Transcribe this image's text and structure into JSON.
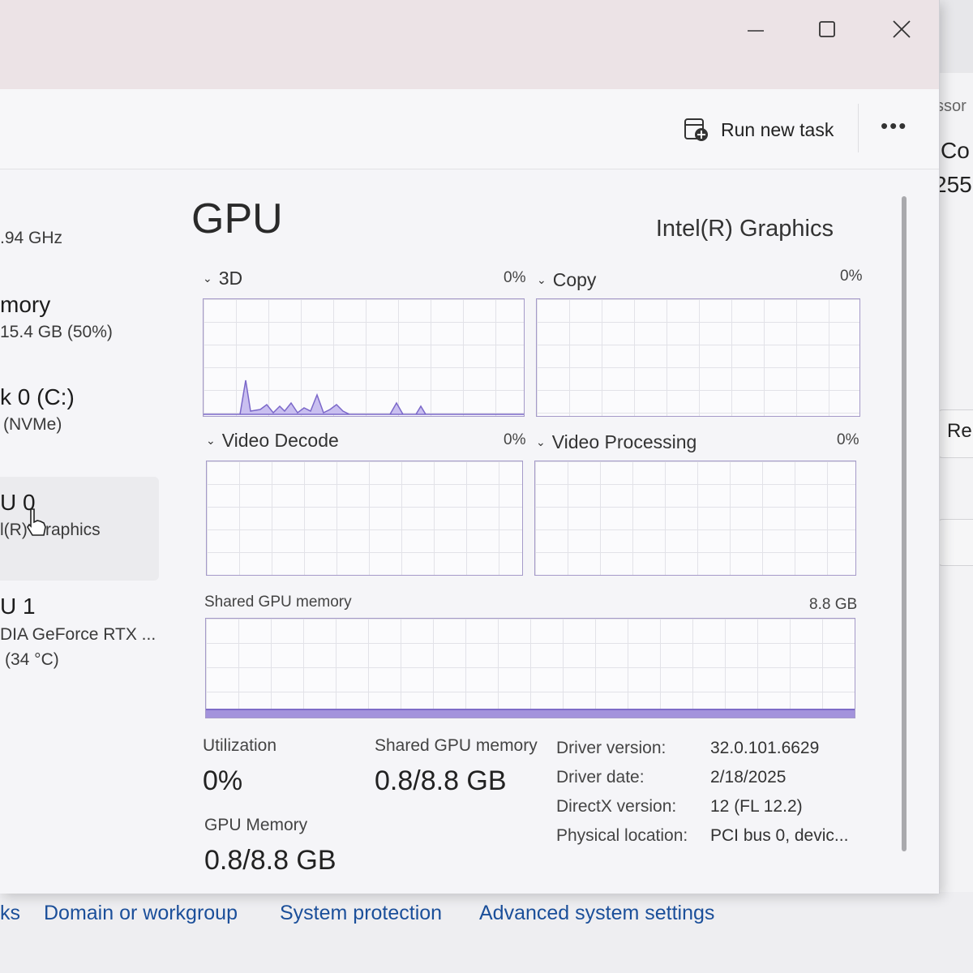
{
  "background_window": {
    "header_partial": "ssor",
    "line1_partial": "Co",
    "line2_partial": "255",
    "button_partial": "Re"
  },
  "bottom_links": {
    "partial_left": "ks",
    "domain": "Domain or workgroup",
    "system_protection": "System protection",
    "advanced": "Advanced system settings"
  },
  "toolbar": {
    "run_new_task": "Run new task",
    "more": "•••"
  },
  "sidebar": {
    "cpu_speed": ".94 GHz",
    "memory_title": "mory",
    "memory_sub": "15.4 GB (50%)",
    "disk_title": "k 0 (C:)",
    "disk_sub": "(NVMe)",
    "gpu0_title": "U 0",
    "gpu0_sub": "l(R) Graphics",
    "gpu1_title": "U 1",
    "gpu1_sub": "DIA GeForce RTX ...",
    "gpu1_temp": "(34 °C)"
  },
  "main": {
    "title": "GPU",
    "adapter_name": "Intel(R) Graphics",
    "engines": [
      {
        "label": "3D",
        "percent": "0%"
      },
      {
        "label": "Copy",
        "percent": "0%"
      },
      {
        "label": "Video Decode",
        "percent": "0%"
      },
      {
        "label": "Video Processing",
        "percent": "0%"
      }
    ],
    "shared_memory_graph": {
      "label": "Shared GPU memory",
      "max": "8.8 GB"
    },
    "stats": {
      "utilization_label": "Utilization",
      "utilization_value": "0%",
      "shared_label": "Shared GPU memory",
      "shared_value": "0.8/8.8 GB",
      "gpu_mem_label": "GPU Memory",
      "gpu_mem_value": "0.8/8.8 GB"
    },
    "info": [
      {
        "key": "Driver version:",
        "value": "32.0.101.6629"
      },
      {
        "key": "Driver date:",
        "value": "2/18/2025"
      },
      {
        "key": "DirectX version:",
        "value": "12 (FL 12.2)"
      },
      {
        "key": "Physical location:",
        "value": "PCI bus 0, devic..."
      }
    ]
  },
  "colors": {
    "graph_border": "#a59ac9",
    "graph_fill": "#a393dc",
    "titlebar": "#ece3e6"
  }
}
